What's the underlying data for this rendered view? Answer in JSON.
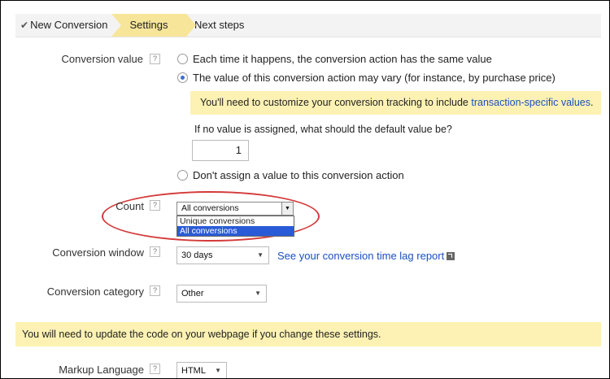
{
  "steps": [
    {
      "label": "New Conversion",
      "check": "✔"
    },
    {
      "label": "Settings"
    },
    {
      "label": "Next steps"
    }
  ],
  "help_label": "?",
  "conversion_value": {
    "label": "Conversion value",
    "options": [
      "Each time it happens, the conversion action has the same value",
      "The value of this conversion action may vary (for instance, by purchase price)",
      "Don't assign a value to this conversion action"
    ],
    "notice_text": "You'll need to customize your conversion tracking to include ",
    "notice_link": "transaction-specific values",
    "notice_end": ".",
    "default_question": "If no value is assigned, what should the default value be?",
    "default_value": "1"
  },
  "count": {
    "label": "Count",
    "selected": "All conversions",
    "options": [
      "Unique conversions",
      "All conversions"
    ]
  },
  "conversion_window": {
    "label": "Conversion window",
    "selected": "30 days",
    "link": "See your conversion time lag report"
  },
  "conversion_category": {
    "label": "Conversion category",
    "selected": "Other"
  },
  "update_notice": "You will need to update the code on your webpage if you change these settings.",
  "markup_language": {
    "label": "Markup Language",
    "selected": "HTML"
  },
  "colors": {
    "active_step": "#f7e59a",
    "notice_bg": "#fdf2b3",
    "link": "#1a4fc4",
    "highlight_circle": "#d43a3a",
    "selected_option": "#2a5bd7"
  }
}
